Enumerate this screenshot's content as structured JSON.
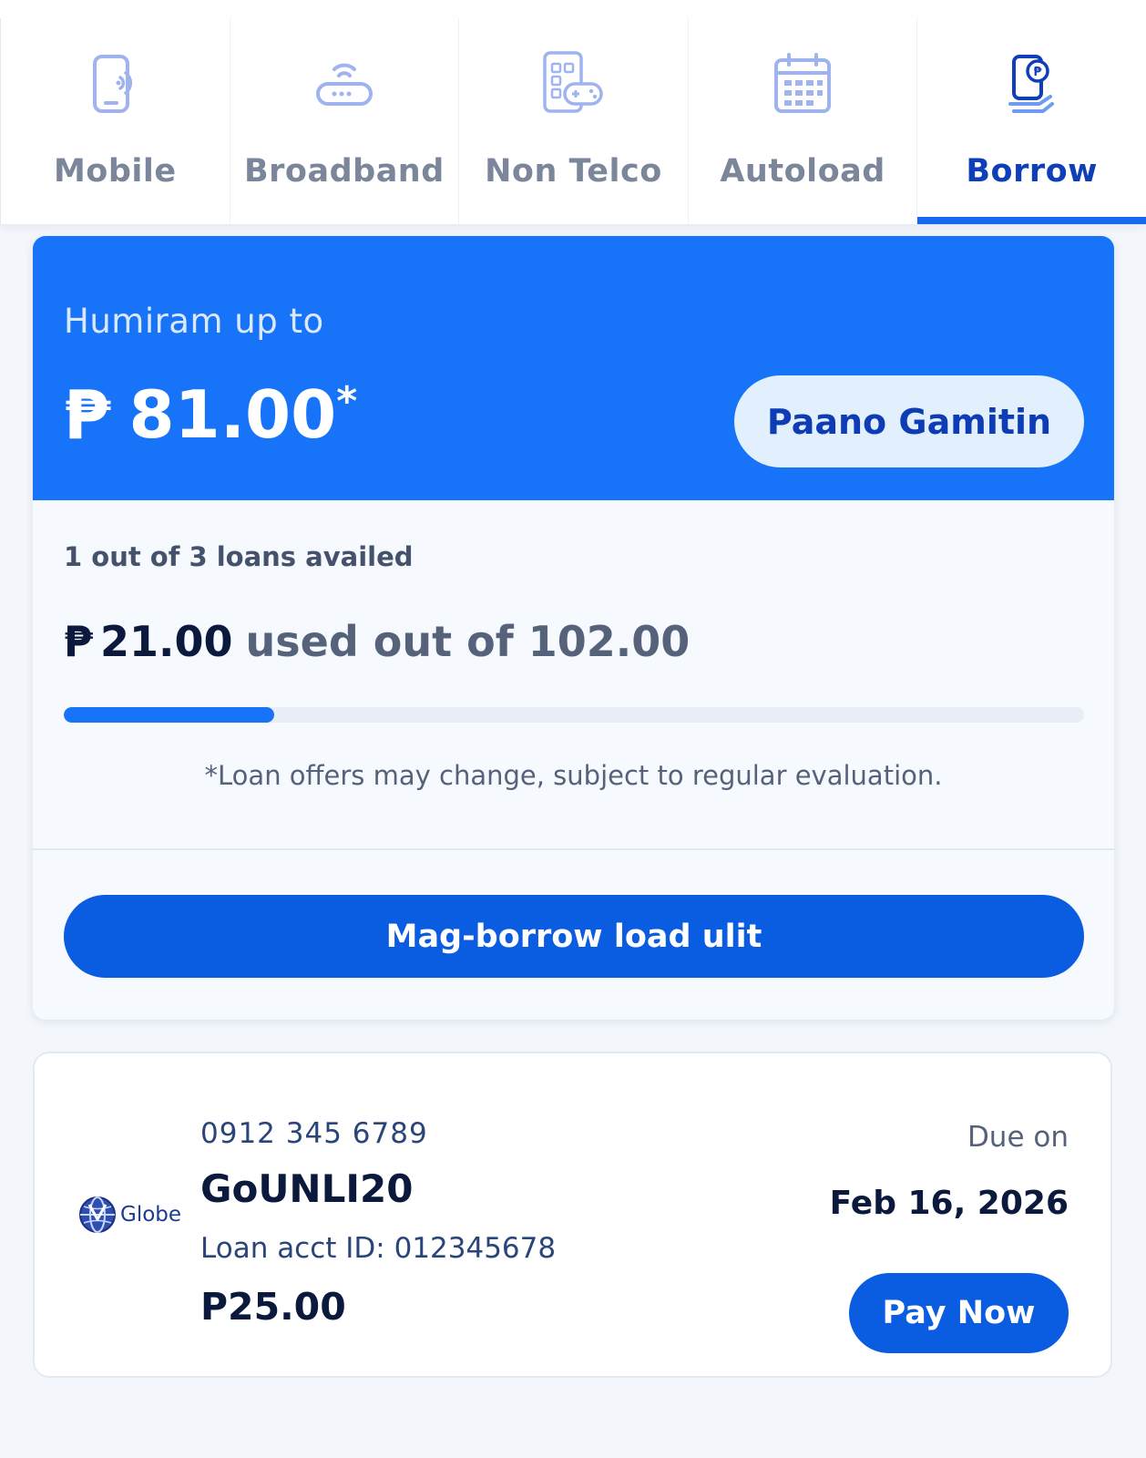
{
  "tabs": [
    {
      "label": "Mobile",
      "icon": "mobile-icon",
      "active": false
    },
    {
      "label": "Broadband",
      "icon": "router-icon",
      "active": false
    },
    {
      "label": "Non Telco",
      "icon": "game-controller-icon",
      "active": false
    },
    {
      "label": "Autoload",
      "icon": "calendar-icon",
      "active": false
    },
    {
      "label": "Borrow",
      "icon": "borrow-phone-icon",
      "active": true
    }
  ],
  "hero": {
    "subtitle": "Humiram up to",
    "currency": "₱",
    "amount": "81.00",
    "asterisk": "*",
    "howto_button": "Paano Gamitin"
  },
  "usage": {
    "loans_count": "1 out of 3 loans availed",
    "currency": "₱",
    "used_amount": "21.00",
    "used_text": "used out of 102.00",
    "progress_fraction": 0.206,
    "disclaimer": "*Loan offers may change, subject to regular evaluation."
  },
  "borrow_button": "Mag-borrow load ulit",
  "loan": {
    "brand": "Globe",
    "number": "0912 345 6789",
    "promo": "GoUNLI20",
    "acct": "Loan acct ID: 012345678",
    "amount": "P25.00",
    "due_label": "Due on",
    "due_date": "Feb 16, 2026",
    "pay_button": "Pay Now"
  },
  "colors": {
    "accent": "#1773f7",
    "button": "#0a5ce0",
    "active_tab_text": "#0f3fb8",
    "inactive_tab_text": "#7b869b"
  }
}
